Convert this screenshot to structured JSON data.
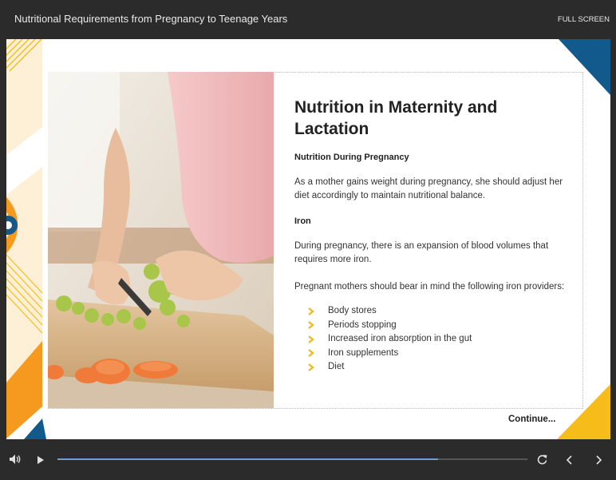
{
  "header": {
    "course_title": "Nutritional Requirements from Pregnancy to Teenage Years",
    "fullscreen_label": "FULL SCREEN"
  },
  "slide": {
    "heading": "Nutrition in Maternity and Lactation",
    "subheading": "Nutrition During Pregnancy",
    "paragraph1": "As a mother gains weight during pregnancy, she should adjust her diet accordingly to maintain nutritional balance.",
    "iron_heading": "Iron",
    "paragraph2": "During pregnancy, there is an expansion of blood volumes that requires more iron.",
    "paragraph3": "Pregnant mothers should bear in mind the following iron providers:",
    "providers": [
      "Body stores",
      "Periods stopping",
      "Increased iron absorption in the gut",
      "Iron supplements",
      "Diet"
    ],
    "continue_label": "Continue...",
    "photo_icon": "pregnant-woman-cutting-vegetables-photo"
  },
  "player": {
    "progress_fraction": 0.81,
    "icons": [
      "volume-icon",
      "play-icon",
      "replay-icon",
      "previous-icon",
      "next-icon"
    ]
  },
  "colors": {
    "background": "#2b2b2b",
    "accent_orange": "#f59a1e",
    "accent_yellow": "#f6bd1a",
    "accent_blue": "#135a8c",
    "bullet_yellow": "#f0b81c",
    "progress": "#6d9fd4"
  }
}
